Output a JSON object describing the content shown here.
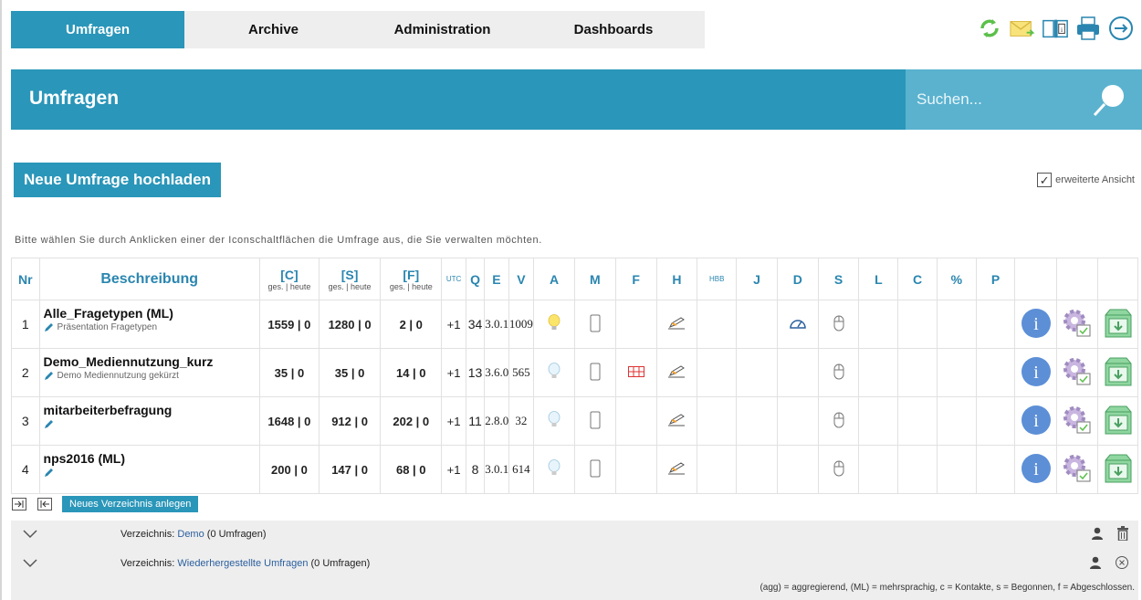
{
  "nav": {
    "tabs": [
      {
        "label": "Umfragen",
        "active": true
      },
      {
        "label": "Archive",
        "active": false
      },
      {
        "label": "Administration",
        "active": false
      },
      {
        "label": "Dashboards",
        "active": false
      }
    ],
    "icons": [
      "refresh-icon",
      "mail-icon",
      "book-info-icon",
      "print-icon",
      "logout-icon"
    ]
  },
  "header": {
    "title": "Umfragen",
    "search_placeholder": "Suchen..."
  },
  "upload_button": "Neue Umfrage hochladen",
  "extended_view": {
    "label": "erweiterte Ansicht",
    "checked": true
  },
  "hint": "Bitte wählen Sie durch Anklicken einer der Iconschaltflächen die Umfrage aus, die Sie verwalten möchten.",
  "table": {
    "headers": {
      "nr": "Nr",
      "desc": "Beschreibung",
      "c": "[C]",
      "s": "[S]",
      "f": "[F]",
      "sub": "ges. | heute",
      "utc": "UTC",
      "q": "Q",
      "e": "E",
      "v": "V",
      "a": "A",
      "m": "M",
      "ff": "F",
      "h": "H",
      "hbb": "HBB",
      "j": "J",
      "d": "D",
      "ss": "S",
      "l": "L",
      "cc": "C",
      "pct": "%",
      "p": "P"
    },
    "rows": [
      {
        "nr": "1",
        "name": "Alle_Fragetypen (ML)",
        "sub": "Präsentation Fragetypen",
        "c": "1559 | 0",
        "s": "1280 | 0",
        "f": "2 | 0",
        "utc": "+1",
        "q": "34",
        "e": "3.0.1",
        "v": "1009",
        "a_lit": true,
        "f_grid": false,
        "d_speed": true
      },
      {
        "nr": "2",
        "name": "Demo_Mediennutzung_kurz",
        "sub": "Demo Mediennutzung gekürzt",
        "c": "35 | 0",
        "s": "35 | 0",
        "f": "14 | 0",
        "utc": "+1",
        "q": "13",
        "e": "3.6.0",
        "v": "565",
        "a_lit": false,
        "f_grid": true,
        "d_speed": false
      },
      {
        "nr": "3",
        "name": "mitarbeiterbefragung",
        "sub": "",
        "c": "1648 | 0",
        "s": "912 | 0",
        "f": "202 | 0",
        "utc": "+1",
        "q": "11",
        "e": "2.8.0",
        "v": "32",
        "a_lit": false,
        "f_grid": false,
        "d_speed": false
      },
      {
        "nr": "4",
        "name": "nps2016 (ML)",
        "sub": "",
        "c": "200 | 0",
        "s": "147 | 0",
        "f": "68 | 0",
        "utc": "+1",
        "q": "8",
        "e": "3.0.1",
        "v": "614",
        "a_lit": false,
        "f_grid": false,
        "d_speed": false
      }
    ]
  },
  "new_directory_button": "Neues Verzeichnis anlegen",
  "directories": [
    {
      "prefix": "Verzeichnis: ",
      "name": "Demo",
      "suffix": " (0 Umfragen)"
    },
    {
      "prefix": "Verzeichnis: ",
      "name": "Wiederhergestellte Umfragen",
      "suffix": " (0 Umfragen)"
    }
  ],
  "legend": "(agg) = aggregierend, (ML) = mehrsprachig, c = Kontakte, s = Begonnen, f = Abgeschlossen.",
  "colors": {
    "accent": "#2a96b9",
    "accent_light": "#5ab2cf",
    "nav_bg": "#eeeeee"
  }
}
